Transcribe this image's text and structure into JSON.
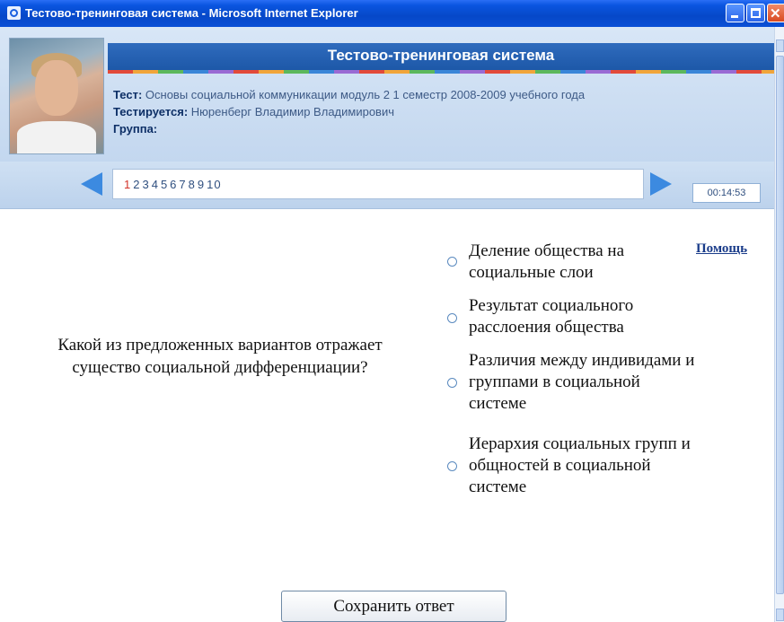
{
  "window": {
    "title": "Тестово-тренинговая система - Microsoft Internet Explorer",
    "close_symbol": "✕"
  },
  "header": {
    "title": "Тестово-тренинговая система",
    "test_label": "Тест:",
    "test_value": "Основы социальной коммуникации модуль 2 1 семестр 2008-2009 учебного года",
    "tested_label": "Тестируется:",
    "tested_value": "Нюренберг Владимир Владимирович",
    "group_label": "Группа:",
    "group_value": ""
  },
  "nav": {
    "question_numbers": [
      "1",
      "2",
      "3",
      "4",
      "5",
      "6",
      "7",
      "8",
      "9",
      "10"
    ],
    "active_index": 0,
    "timer": "00:14:53"
  },
  "content": {
    "help": "Помощь",
    "question": "Какой из предложенных вариантов отражает существо социальной дифференциации?",
    "options": [
      [
        "Деление общества на",
        "социальные слои"
      ],
      [
        "Результат социального",
        "расслоения общества"
      ],
      [
        "Различия между индивидами и",
        "группами в социальной",
        "системе"
      ],
      [
        "Иерархия социальных групп и",
        "общностей в социальной",
        "системе"
      ]
    ],
    "save_button": "Сохранить ответ"
  },
  "icons": {
    "app": "ie-icon",
    "prev": "arrow-left-icon",
    "next": "arrow-right-icon",
    "radio": "radio-icon"
  },
  "colors": {
    "titlebar": "#0648c8",
    "header_band": "#2f6bbd",
    "active_question": "#d2332a",
    "arrows": "#3c8ae0"
  }
}
